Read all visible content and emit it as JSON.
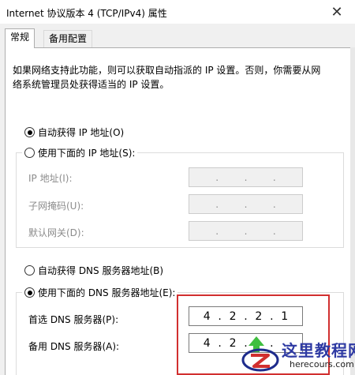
{
  "window": {
    "title": "Internet 协议版本 4 (TCP/IPv4) 属性"
  },
  "tabs": [
    {
      "label": "常规"
    },
    {
      "label": "备用配置"
    }
  ],
  "description": [
    "如果网络支持此功能，则可以获取自动指派的 IP 设置。否则，你需要从网",
    "络系统管理员处获得适当的 IP 设置。"
  ],
  "ip": {
    "auto_label": "自动获得 IP 地址(O)",
    "manual_label": "使用下面的 IP 地址(S):",
    "fields": [
      {
        "label": "IP 地址(I):",
        "octets": [
          "",
          "",
          "",
          ""
        ]
      },
      {
        "label": "子网掩码(U):",
        "octets": [
          "",
          "",
          "",
          ""
        ]
      },
      {
        "label": "默认网关(D):",
        "octets": [
          "",
          "",
          "",
          ""
        ]
      }
    ]
  },
  "dns": {
    "auto_label": "自动获得 DNS 服务器地址(B)",
    "manual_label": "使用下面的 DNS 服务器地址(E):",
    "preferred_label": "首选 DNS 服务器(P):",
    "preferred_octets": [
      "4",
      "2",
      "2",
      "1"
    ],
    "alternate_label": "备用 DNS 服务器(A):",
    "alternate_octets": [
      "4",
      "2",
      "",
      ""
    ]
  },
  "watermark": {
    "name": "这里教程网",
    "url": "herecours.com"
  },
  "icons": {
    "close": "close-icon",
    "logo": "site-logo-icon"
  },
  "colors": {
    "highlight": "#d12f2f",
    "watermark": "#2e3aa3"
  }
}
